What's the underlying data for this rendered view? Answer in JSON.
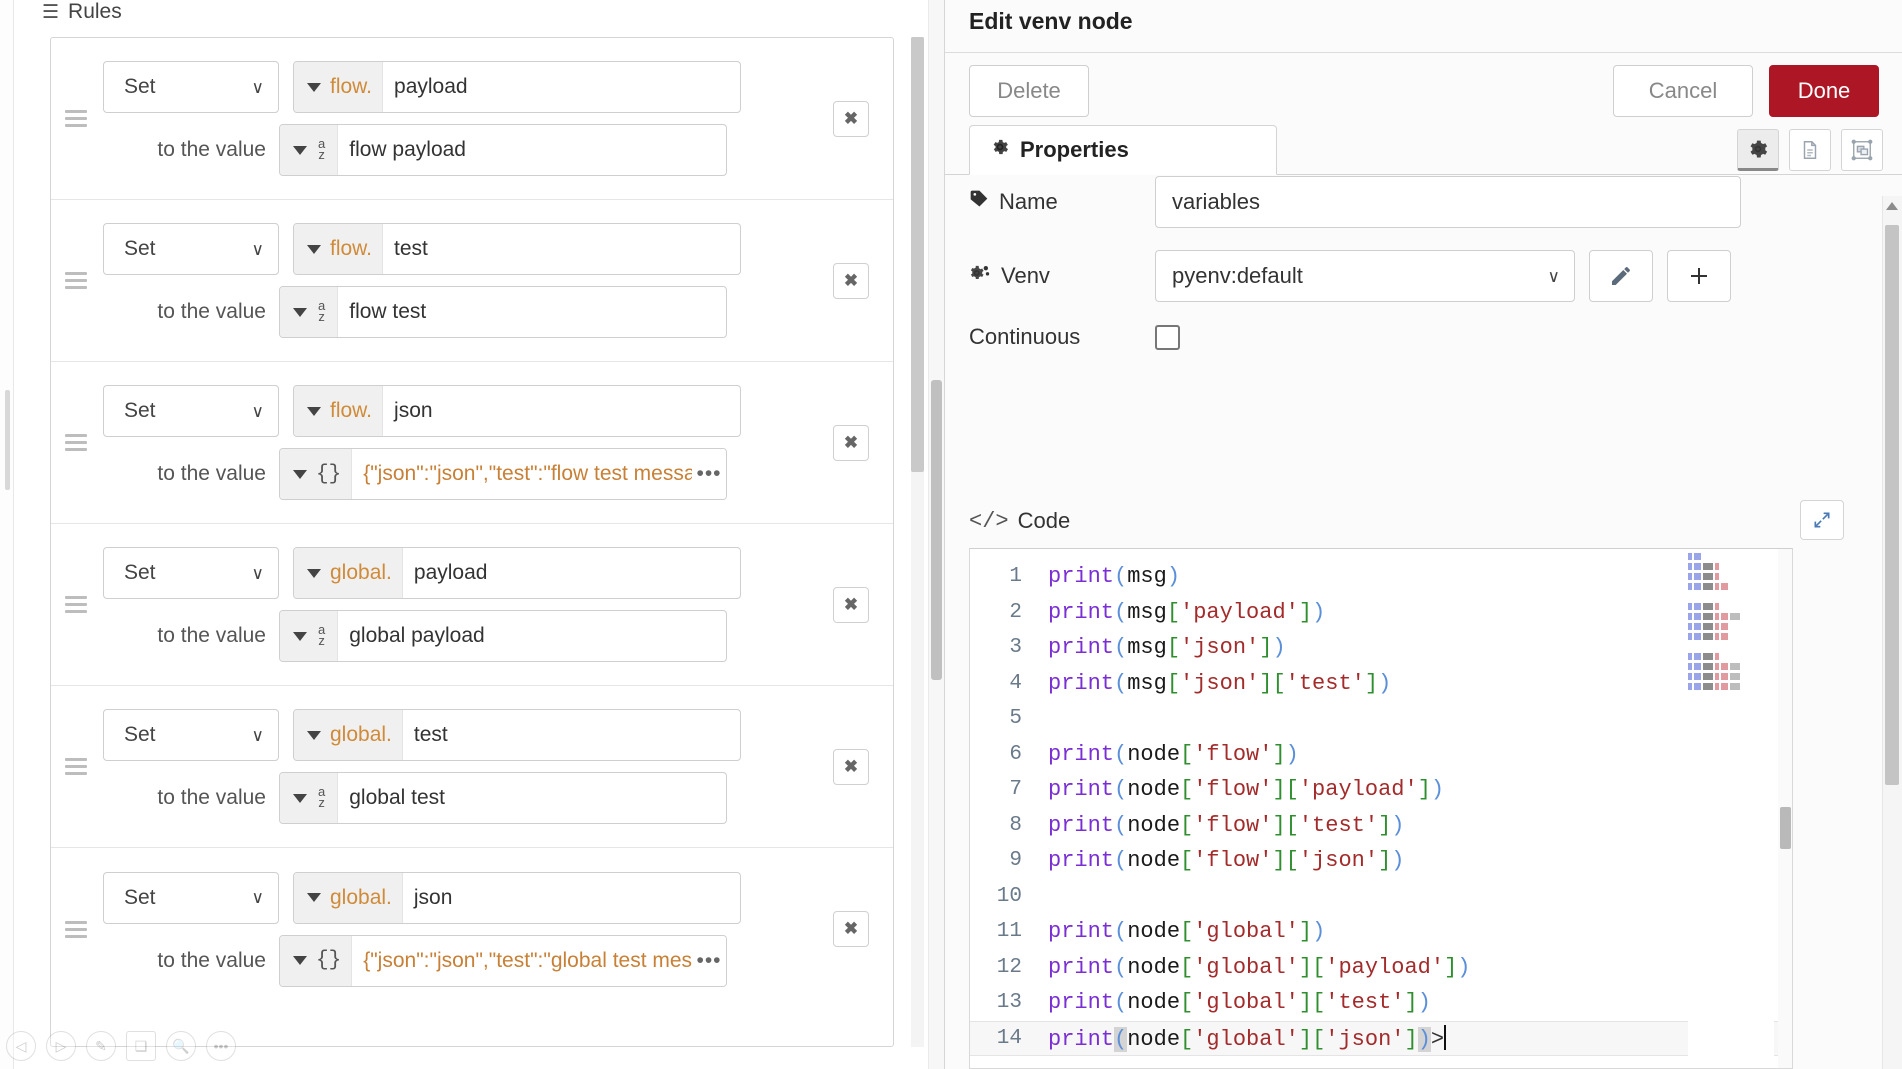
{
  "left_panel": {
    "section_title": "Rules",
    "list_icon": "list-icon",
    "to_the_value_label": "to the value",
    "set_label": "Set",
    "delete_glyph": "✖",
    "dots_glyph": "•••",
    "rules": [
      {
        "operation": "Set",
        "scope": "flow.",
        "property": "payload",
        "value_type_icon": "az-icon",
        "value": "flow payload",
        "has_overflow": false
      },
      {
        "operation": "Set",
        "scope": "flow.",
        "property": "test",
        "value_type_icon": "az-icon",
        "value": "flow test",
        "has_overflow": false
      },
      {
        "operation": "Set",
        "scope": "flow.",
        "property": "json",
        "value_type_icon": "json-icon",
        "value": "{\"json\":\"json\",\"test\":\"flow test message",
        "has_overflow": true
      },
      {
        "operation": "Set",
        "scope": "global.",
        "property": "payload",
        "value_type_icon": "az-icon",
        "value": "global payload",
        "has_overflow": false
      },
      {
        "operation": "Set",
        "scope": "global.",
        "property": "test",
        "value_type_icon": "az-icon",
        "value": "global test",
        "has_overflow": false
      },
      {
        "operation": "Set",
        "scope": "global.",
        "property": "json",
        "value_type_icon": "json-icon",
        "value": "{\"json\":\"json\",\"test\":\"global test messa",
        "has_overflow": true
      }
    ],
    "mini_toolbar": [
      {
        "icon": "navigate-back-icon",
        "glyph": "◁"
      },
      {
        "icon": "navigate-forward-icon",
        "glyph": "▷"
      },
      {
        "icon": "edit-pencil-icon",
        "glyph": "✎"
      },
      {
        "icon": "layers-icon",
        "glyph": "❏"
      },
      {
        "icon": "search-icon",
        "glyph": "🔍"
      },
      {
        "icon": "more-options-icon",
        "glyph": "•••"
      }
    ]
  },
  "dialog": {
    "title": "Edit venv node",
    "buttons": {
      "delete": "Delete",
      "cancel": "Cancel",
      "done": "Done"
    },
    "accent_color": "#ad1625",
    "tabs": {
      "properties_label": "Properties",
      "properties_icon": "gear-icon",
      "icon_buttons": [
        {
          "name": "settings-tab-icon",
          "active": true
        },
        {
          "name": "description-tab-icon",
          "active": false
        },
        {
          "name": "appearance-tab-icon",
          "active": false
        }
      ]
    },
    "form": {
      "name_label": "Name",
      "name_icon": "tag-icon",
      "name_value": "variables",
      "venv_label": "Venv",
      "venv_icon": "cogs-icon",
      "venv_value": "pyenv:default",
      "venv_edit_icon": "pencil-icon",
      "venv_add_icon": "plus-icon",
      "continuous_label": "Continuous",
      "continuous_checked": false
    },
    "code": {
      "label": "Code",
      "label_icon": "code-brackets-icon",
      "expand_icon": "expand-icon",
      "active_line": 14,
      "lines": [
        {
          "num": "1",
          "text": "print(msg)"
        },
        {
          "num": "2",
          "text": "print(msg['payload'])"
        },
        {
          "num": "3",
          "text": "print(msg['json'])"
        },
        {
          "num": "4",
          "text": "print(msg['json']['test'])"
        },
        {
          "num": "5",
          "text": ""
        },
        {
          "num": "6",
          "text": "print(node['flow'])"
        },
        {
          "num": "7",
          "text": "print(node['flow']['payload'])"
        },
        {
          "num": "8",
          "text": "print(node['flow']['test'])"
        },
        {
          "num": "9",
          "text": "print(node['flow']['json'])"
        },
        {
          "num": "10",
          "text": ""
        },
        {
          "num": "11",
          "text": "print(node['global'])"
        },
        {
          "num": "12",
          "text": "print(node['global']['payload'])"
        },
        {
          "num": "13",
          "text": "print(node['global']['test'])"
        },
        {
          "num": "14",
          "text": "print(node['global']['json'])"
        }
      ],
      "syntax_colors": {
        "function": "#7a2fd4",
        "variable": "#1a1a1a",
        "paren": "#5b8fd9",
        "bracket": "#2f8f2f",
        "string": "#a32b2b"
      }
    }
  }
}
